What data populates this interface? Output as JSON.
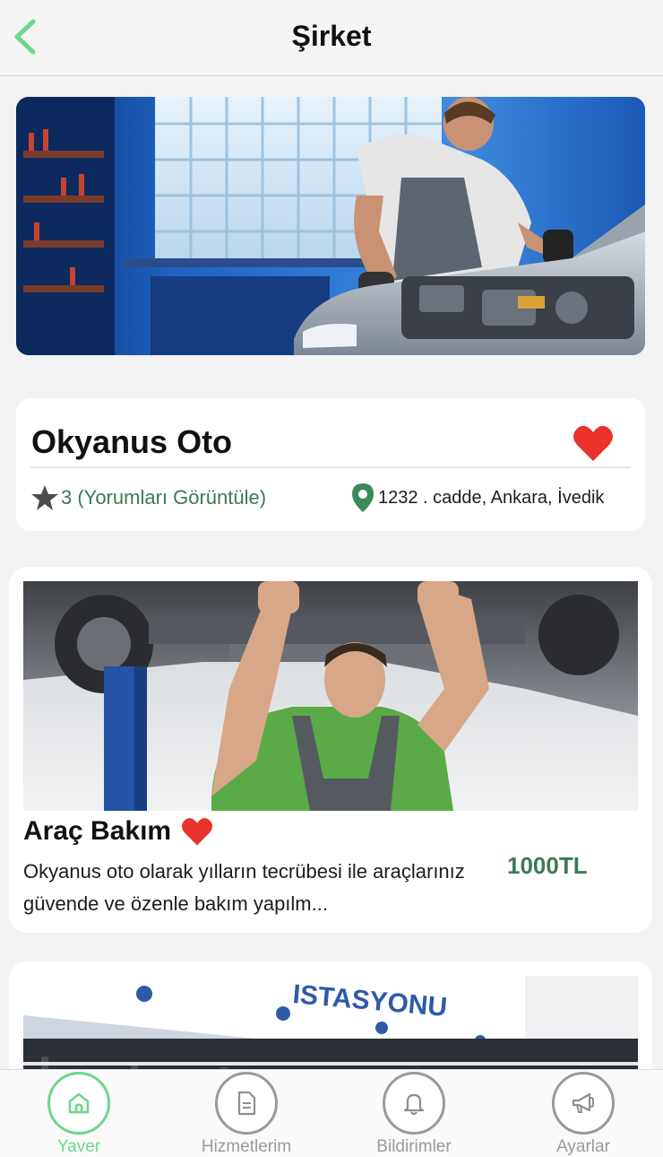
{
  "header": {
    "title": "Şirket",
    "back_icon": "chevron-left-icon"
  },
  "company": {
    "name": "Okyanus Oto",
    "favorite": true,
    "rating_text": "3 (Yorumları Görüntüle)",
    "address": "1232 . cadde, Ankara, İvedik"
  },
  "services": [
    {
      "title": "Araç Bakım",
      "favorite": true,
      "description": "Okyanus oto olarak yılların tecrübesi ile araçlarınız güvende ve özenle bakım yapılm...",
      "price": "1000TL"
    },
    {
      "sign_text": "ISTASYONU"
    }
  ],
  "nav": {
    "items": [
      {
        "label": "Yaver",
        "icon": "home-icon",
        "active": true
      },
      {
        "label": "Hizmetlerim",
        "icon": "document-icon",
        "active": false
      },
      {
        "label": "Bildirimler",
        "icon": "bell-icon",
        "active": false
      },
      {
        "label": "Ayarlar",
        "icon": "megaphone-icon",
        "active": false
      }
    ]
  },
  "colors": {
    "accent_green": "#6ed68d",
    "text_green": "#3b7a55",
    "heart_red": "#e8322b",
    "inactive_gray": "#9a9a9a"
  }
}
